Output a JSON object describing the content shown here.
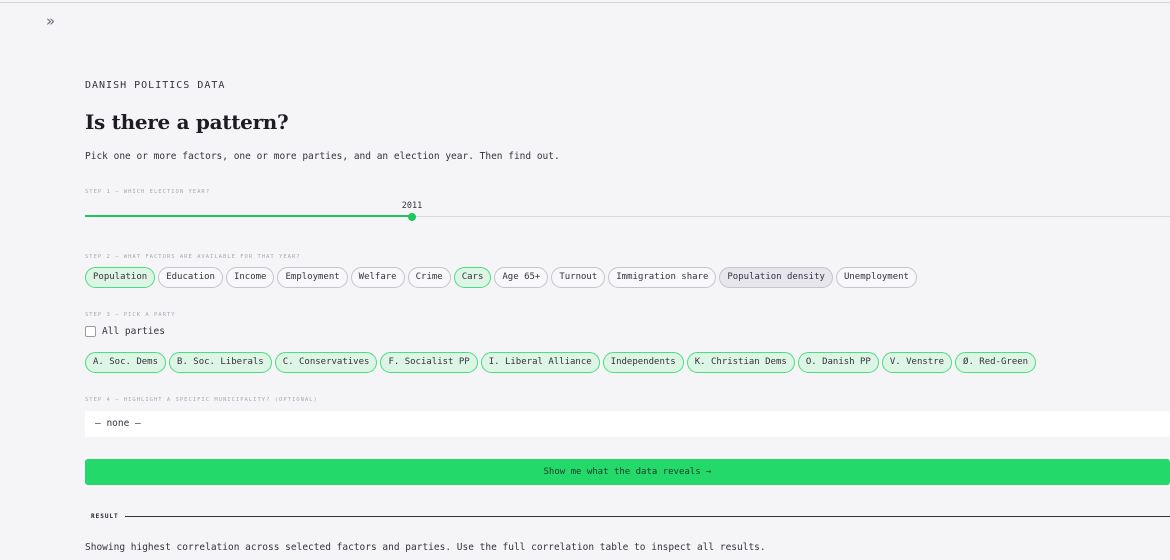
{
  "sidebar": {
    "expand_icon": "chevron-double-right-icon",
    "expand_glyph": "»"
  },
  "header": {
    "eyebrow": "DANISH POLITICS DATA",
    "title": "Is there a pattern?",
    "intro": "Pick one or more factors, one or more parties, and an election year. Then find out."
  },
  "colors": {
    "accent": "#22c55e",
    "button": "#22d96a",
    "chip_selected_bg": "#dcf5e4",
    "background": "#f5f5f8"
  },
  "step1": {
    "label": "STEP 1 — WHICH ELECTION YEAR?",
    "value": "2011",
    "fraction": 0.3
  },
  "step2": {
    "label": "STEP 2 — WHAT FACTORS ARE AVAILABLE FOR THAT YEAR?",
    "factors": [
      {
        "label": "Population",
        "state": "selected"
      },
      {
        "label": "Education",
        "state": "normal"
      },
      {
        "label": "Income",
        "state": "normal"
      },
      {
        "label": "Employment",
        "state": "normal"
      },
      {
        "label": "Welfare",
        "state": "normal"
      },
      {
        "label": "Crime",
        "state": "normal"
      },
      {
        "label": "Cars",
        "state": "selected"
      },
      {
        "label": "Age 65+",
        "state": "normal"
      },
      {
        "label": "Turnout",
        "state": "normal"
      },
      {
        "label": "Immigration share",
        "state": "normal"
      },
      {
        "label": "Population density",
        "state": "soft"
      },
      {
        "label": "Unemployment",
        "state": "normal"
      }
    ]
  },
  "step3": {
    "label": "STEP 3 — PICK A PARTY",
    "all_parties_label": "All parties",
    "all_parties_checked": false,
    "parties": [
      {
        "label": "A. Soc. Dems",
        "state": "selected"
      },
      {
        "label": "B. Soc. Liberals",
        "state": "selected"
      },
      {
        "label": "C. Conservatives",
        "state": "selected"
      },
      {
        "label": "F. Socialist PP",
        "state": "selected"
      },
      {
        "label": "I. Liberal Alliance",
        "state": "selected"
      },
      {
        "label": "Independents",
        "state": "selected"
      },
      {
        "label": "K. Christian Dems",
        "state": "selected"
      },
      {
        "label": "O. Danish PP",
        "state": "selected"
      },
      {
        "label": "V. Venstre",
        "state": "selected"
      },
      {
        "label": "Ø. Red-Green",
        "state": "selected"
      }
    ]
  },
  "step4": {
    "label": "STEP 4 — HIGHLIGHT A SPECIFIC MUNICIPALITY? (OPTIONAL)",
    "value": "— none —"
  },
  "cta": {
    "label": "Show me what the data reveals →"
  },
  "result": {
    "label": "RESULT",
    "text": "Showing highest correlation across selected factors and parties. Use the full correlation table to inspect all results."
  }
}
